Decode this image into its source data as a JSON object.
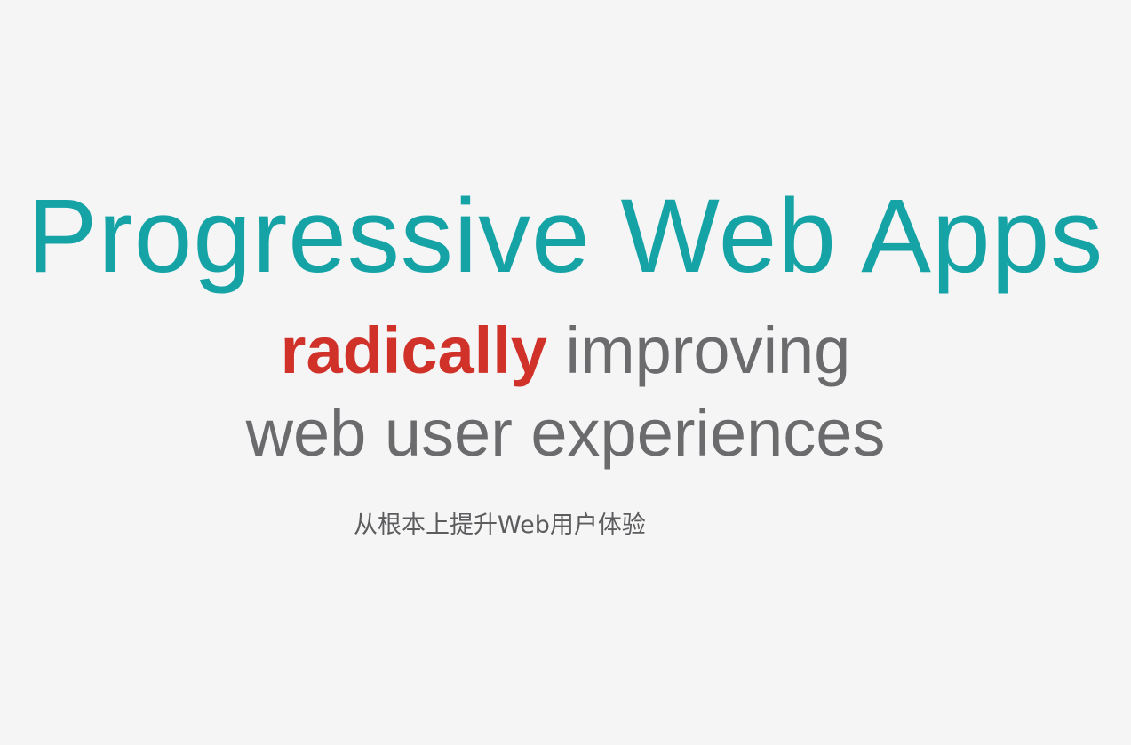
{
  "slide": {
    "title": "Progressive Web Apps",
    "tagline": {
      "emphasis": "radically",
      "rest": " improving",
      "line2": "web user experiences"
    },
    "subtitle_cn": "从根本上提升Web用户体验"
  },
  "colors": {
    "background": "#f5f5f6",
    "title": "#15a3a6",
    "emphasis": "#d0322a",
    "body_text": "#6b6b6d"
  }
}
